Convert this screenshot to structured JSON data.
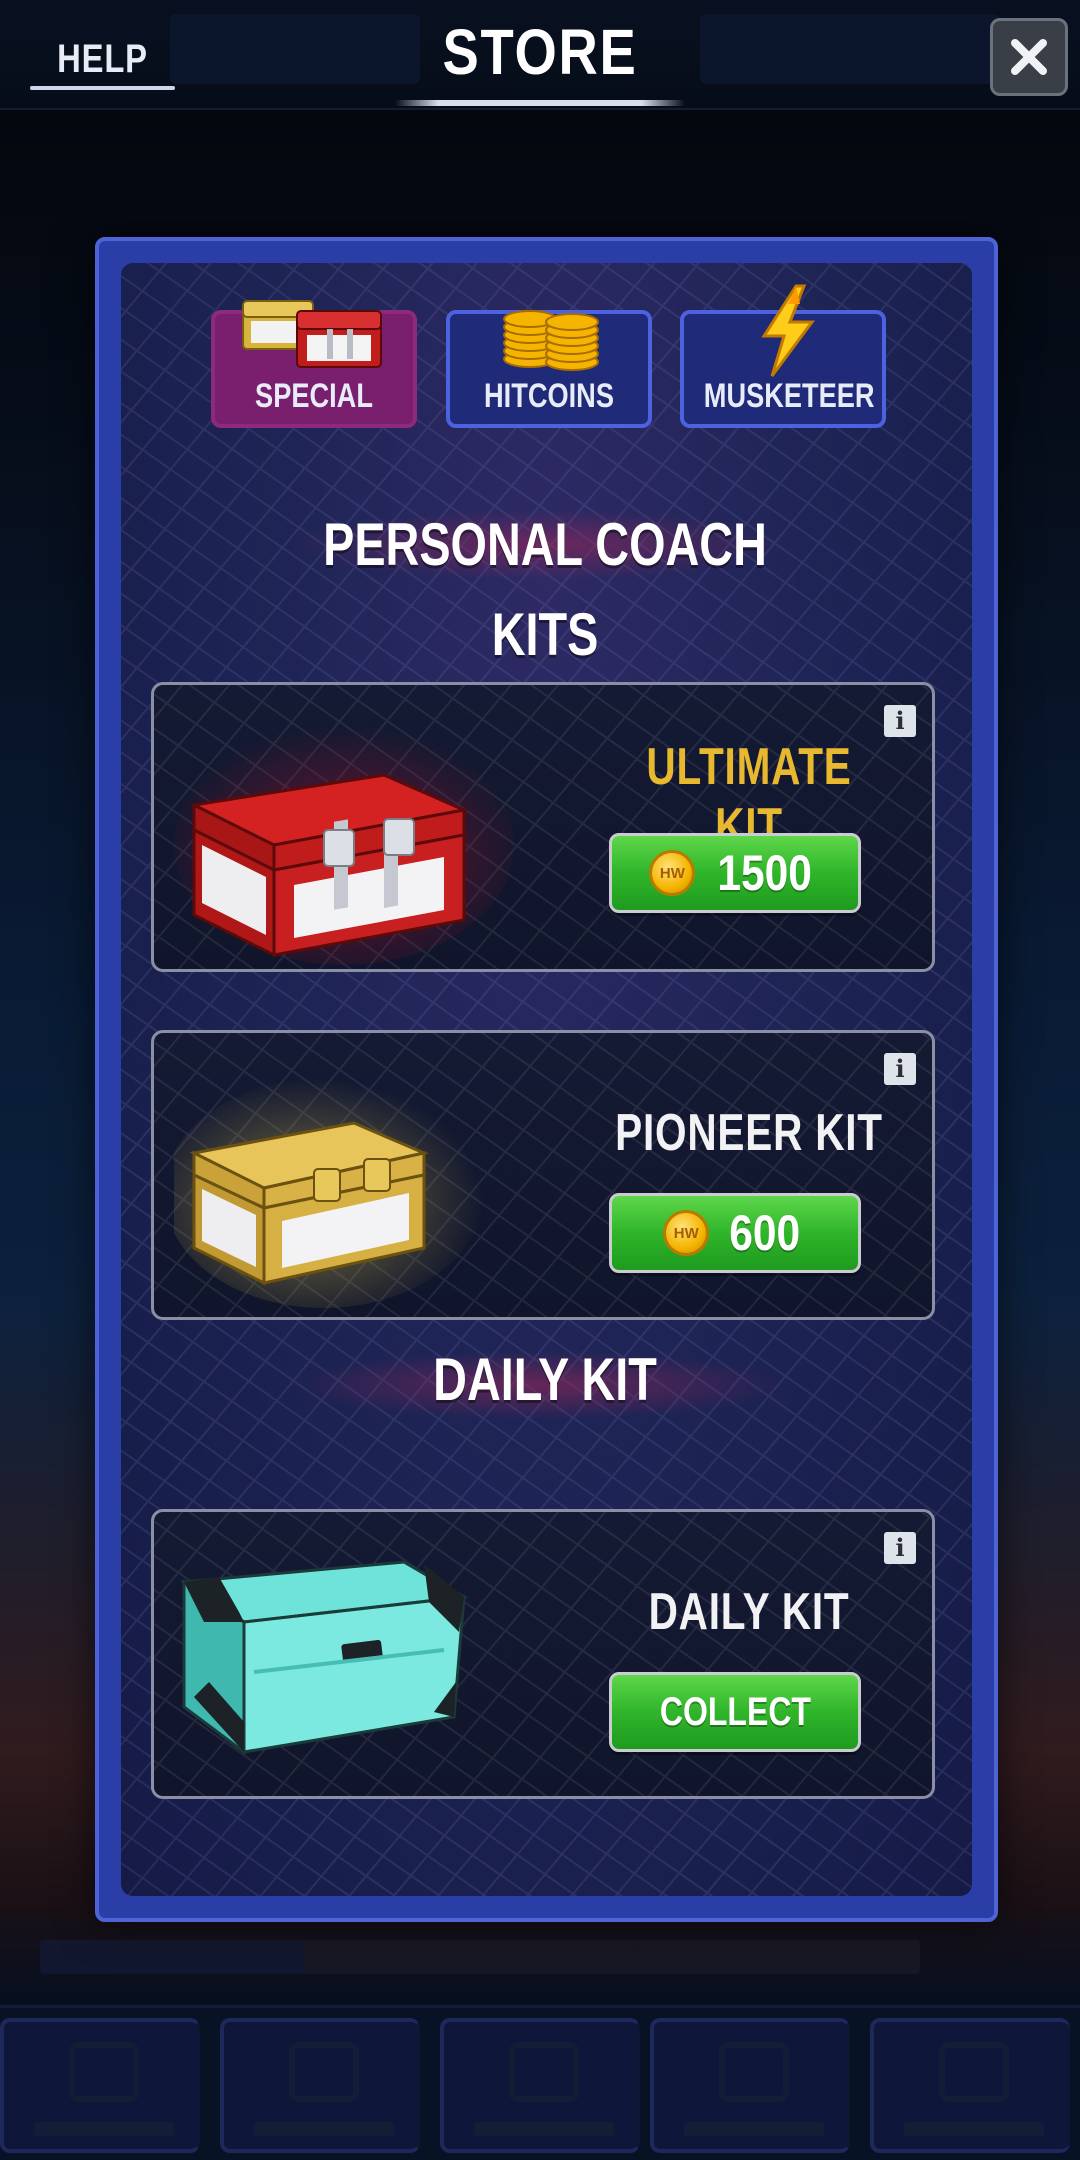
{
  "header": {
    "help_label": "HELP",
    "title": "STORE",
    "close_icon": "close-icon"
  },
  "tabs": [
    {
      "label": "SPECIAL",
      "icon": "special-chests-icon",
      "active": true
    },
    {
      "label": "HITCOINS",
      "icon": "hitcoins-stack-icon",
      "active": false
    },
    {
      "label": "MUSKETEER",
      "icon": "lightning-bolt-icon",
      "active": false
    }
  ],
  "sections": {
    "personal": {
      "title": "PERSONAL COACH KITS"
    },
    "daily": {
      "title": "DAILY KIT"
    }
  },
  "kits": {
    "ultimate": {
      "name": "ULTIMATE KIT",
      "price": "1500",
      "coin_label": "HW",
      "color": "#e8b92e",
      "icon": "red-chest-icon"
    },
    "pioneer": {
      "name": "PIONEER KIT",
      "price": "600",
      "coin_label": "HW",
      "color": "#f2f2f4",
      "icon": "gold-chest-icon"
    },
    "daily": {
      "name": "DAILY KIT",
      "action": "COLLECT",
      "color": "#f2f2f4",
      "icon": "cyan-chest-icon"
    }
  },
  "colors": {
    "modal_border": "#4e63d6",
    "tab_active": "#7a1f6e",
    "tab_inactive_border": "#4d62e0",
    "buy_button": "#2fb52a"
  }
}
